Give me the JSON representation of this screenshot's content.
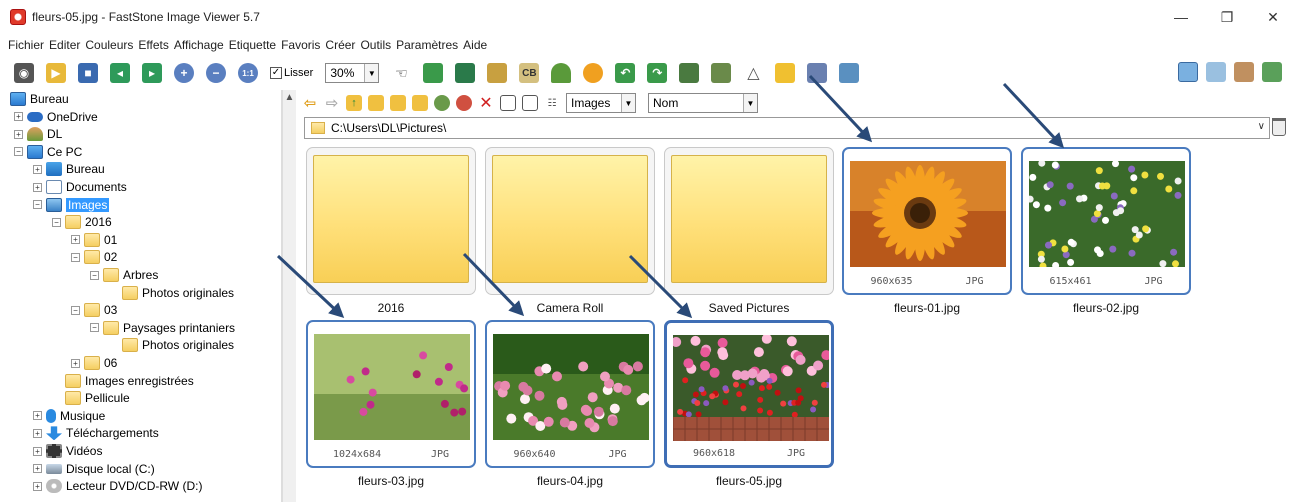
{
  "window": {
    "title": "fleurs-05.jpg  -  FastStone Image Viewer 5.7",
    "controls": [
      "—",
      "❐",
      "✕"
    ]
  },
  "menu": [
    "Fichier",
    "Editer",
    "Couleurs",
    "Effets",
    "Affichage",
    "Etiquette",
    "Favoris",
    "Créer",
    "Outils",
    "Paramètres",
    "Aide"
  ],
  "toolbar": {
    "smooth_label": "Lisser",
    "smooth_checked": true,
    "zoom_value": "30%"
  },
  "browser": {
    "filter_value": "Images",
    "sort_value": "Nom",
    "path": "C:\\Users\\DL\\Pictures\\"
  },
  "tree": [
    {
      "label": "Bureau",
      "icon": "pc",
      "level": 0,
      "exp": ""
    },
    {
      "label": "OneDrive",
      "icon": "cloud",
      "level": 1,
      "exp": "+"
    },
    {
      "label": "DL",
      "icon": "user",
      "level": 1,
      "exp": "+"
    },
    {
      "label": "Ce PC",
      "icon": "pc",
      "level": 1,
      "exp": "-"
    },
    {
      "label": "Bureau",
      "icon": "blue",
      "level": 2,
      "exp": "+"
    },
    {
      "label": "Documents",
      "icon": "doc",
      "level": 2,
      "exp": "+"
    },
    {
      "label": "Images",
      "icon": "img",
      "level": 2,
      "exp": "-",
      "selected": true
    },
    {
      "label": "2016",
      "icon": "folder",
      "level": 3,
      "exp": "-"
    },
    {
      "label": "01",
      "icon": "folder",
      "level": 4,
      "exp": "+"
    },
    {
      "label": "02",
      "icon": "folder",
      "level": 4,
      "exp": "-"
    },
    {
      "label": "Arbres",
      "icon": "folder",
      "level": 5,
      "exp": "-"
    },
    {
      "label": "Photos originales",
      "icon": "folder",
      "level": 6,
      "exp": ""
    },
    {
      "label": "03",
      "icon": "folder",
      "level": 4,
      "exp": "-"
    },
    {
      "label": "Paysages printaniers",
      "icon": "folder",
      "level": 5,
      "exp": "-"
    },
    {
      "label": "Photos originales",
      "icon": "folder",
      "level": 6,
      "exp": ""
    },
    {
      "label": "06",
      "icon": "folder",
      "level": 4,
      "exp": "+"
    },
    {
      "label": "Images enregistrées",
      "icon": "folder",
      "level": 3,
      "exp": ""
    },
    {
      "label": "Pellicule",
      "icon": "folder",
      "level": 3,
      "exp": ""
    },
    {
      "label": "Musique",
      "icon": "music",
      "level": 2,
      "exp": "+"
    },
    {
      "label": "Téléchargements",
      "icon": "down",
      "level": 2,
      "exp": "+"
    },
    {
      "label": "Vidéos",
      "icon": "video",
      "level": 2,
      "exp": "+"
    },
    {
      "label": "Disque local (C:)",
      "icon": "disk",
      "level": 2,
      "exp": "+"
    },
    {
      "label": "Lecteur DVD/CD-RW (D:)",
      "icon": "dvd",
      "level": 2,
      "exp": "+"
    }
  ],
  "items": [
    {
      "name": "2016",
      "kind": "folder"
    },
    {
      "name": "Camera Roll",
      "kind": "folder"
    },
    {
      "name": "Saved Pictures",
      "kind": "folder"
    },
    {
      "name": "fleurs-01.jpg",
      "kind": "image",
      "dims": "960x635",
      "type": "JPG",
      "selected": true,
      "scene": "orange"
    },
    {
      "name": "fleurs-02.jpg",
      "kind": "image",
      "dims": "615x461",
      "type": "JPG",
      "selected": true,
      "scene": "daisies"
    },
    {
      "name": "fleurs-03.jpg",
      "kind": "image",
      "dims": "1024x684",
      "type": "JPG",
      "selected": true,
      "scene": "cosmos"
    },
    {
      "name": "fleurs-04.jpg",
      "kind": "image",
      "dims": "960x640",
      "type": "JPG",
      "selected": true,
      "scene": "roses"
    },
    {
      "name": "fleurs-05.jpg",
      "kind": "image",
      "dims": "960x618",
      "type": "JPG",
      "selected": true,
      "current": true,
      "scene": "garden"
    }
  ],
  "colors": {
    "selection_border": "#4a7bbf",
    "tree_selected": "#3399ff",
    "annotation_arrow": "#2a4a78"
  }
}
